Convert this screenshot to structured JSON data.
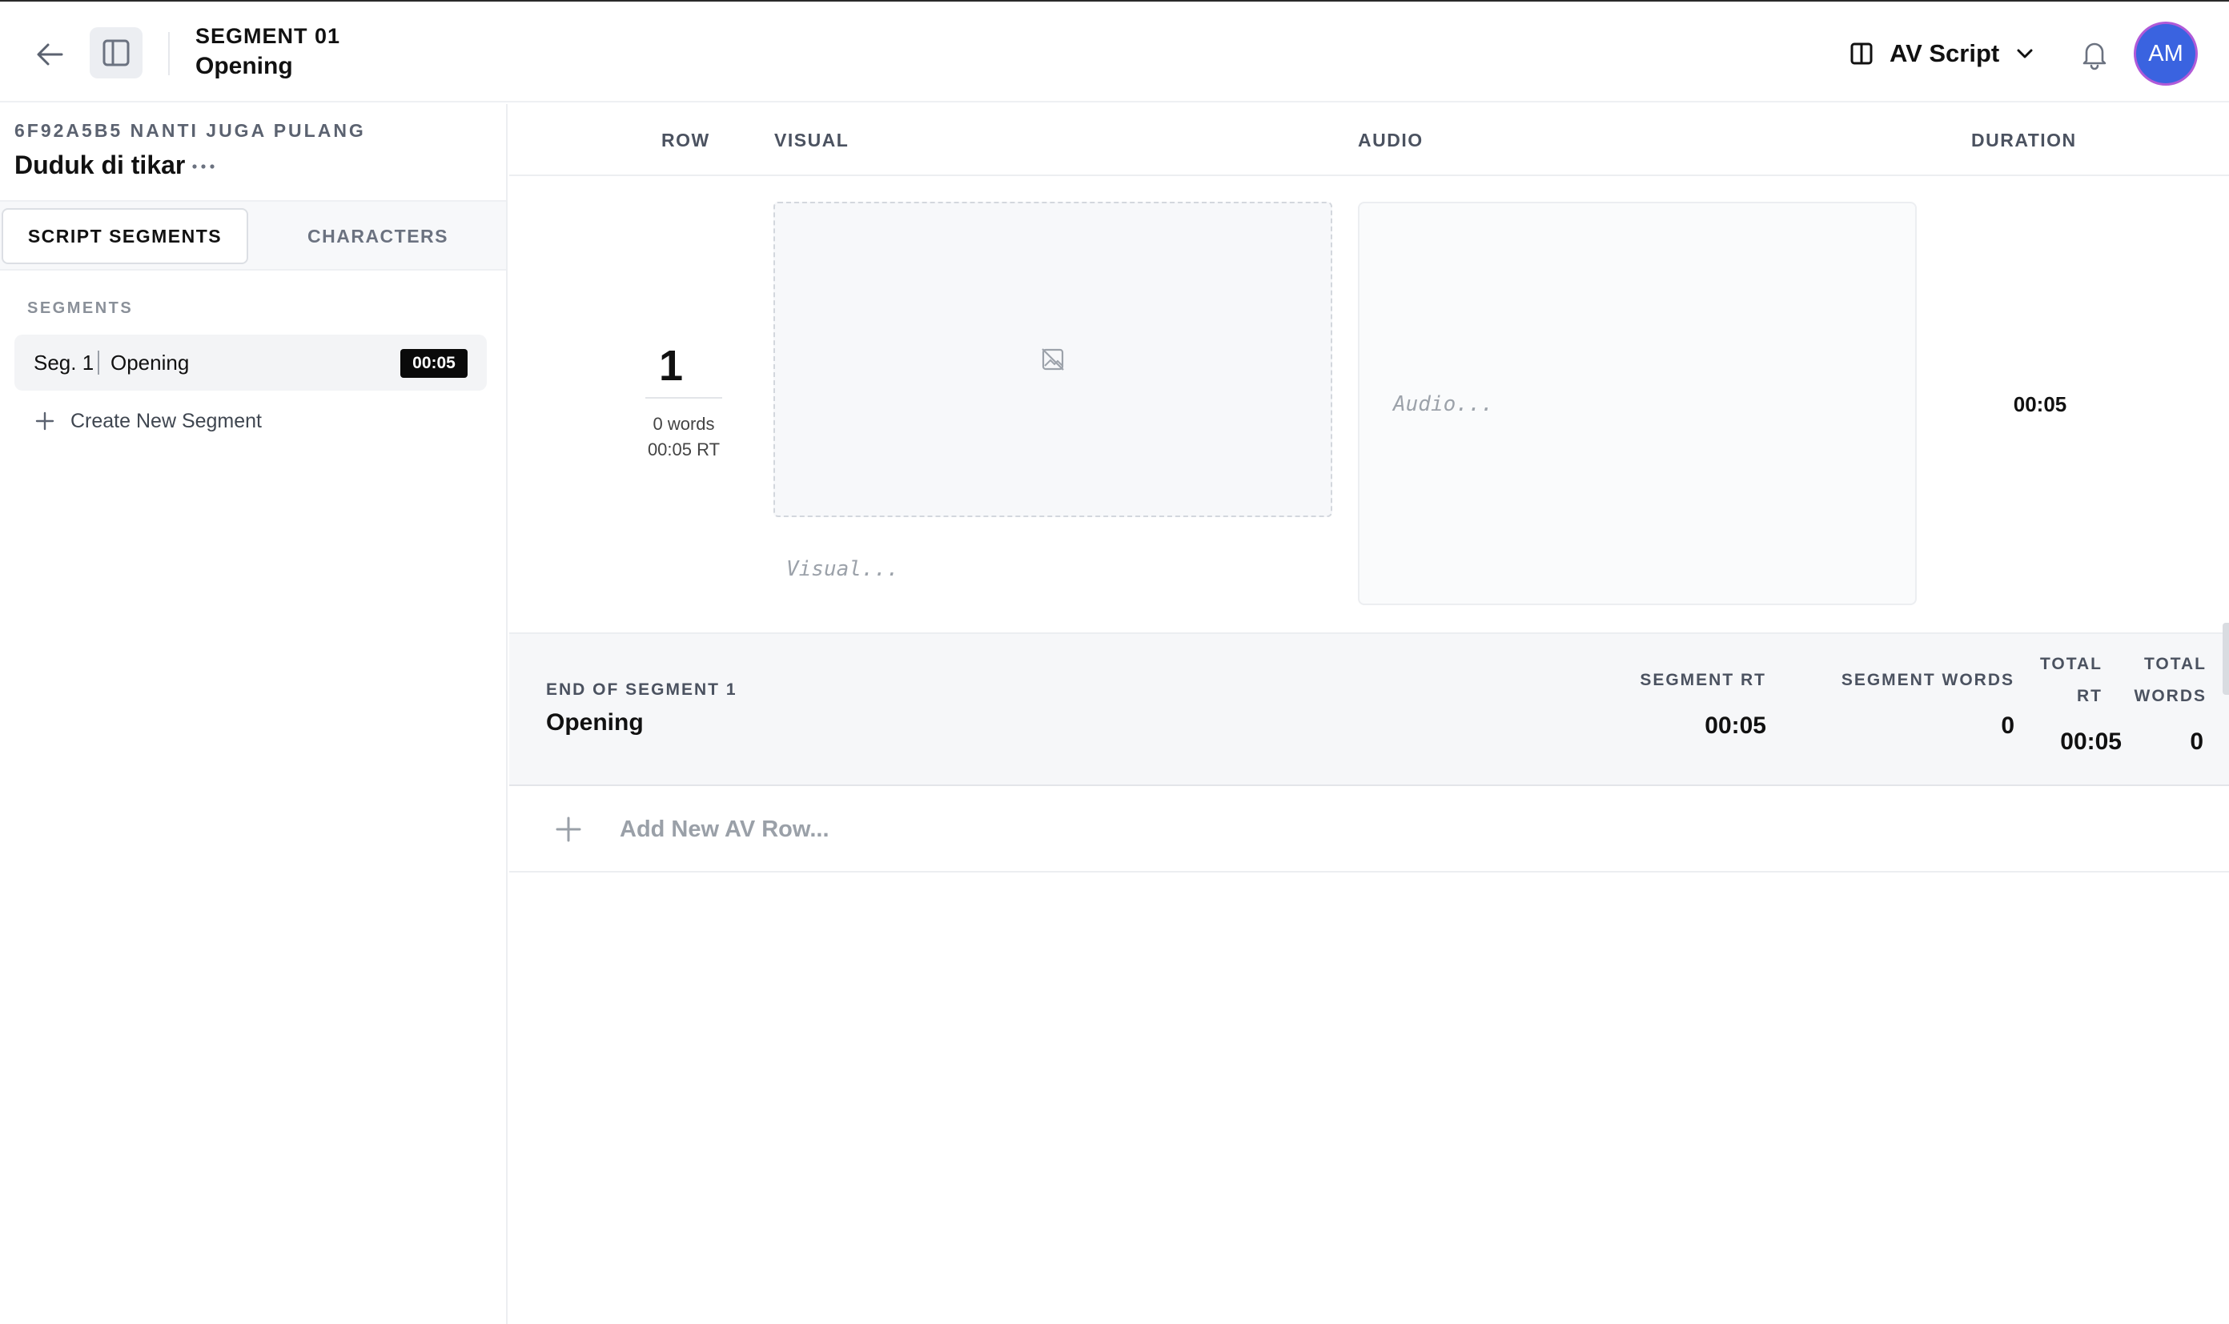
{
  "header": {
    "segment_number": "SEGMENT 01",
    "segment_name": "Opening",
    "view_mode": "AV Script",
    "user_initials": "AM"
  },
  "sidebar": {
    "project_id": "6F92A5B5 NANTI JUGA PULANG",
    "project_title": "Duduk di tikar",
    "tabs": [
      {
        "label": "SCRIPT SEGMENTS",
        "active": true
      },
      {
        "label": "CHARACTERS",
        "active": false
      }
    ],
    "segments_heading": "SEGMENTS",
    "segments": [
      {
        "label": "Seg. 1",
        "title": "Opening",
        "duration": "00:05"
      }
    ],
    "create_label": "Create New Segment"
  },
  "table": {
    "columns": {
      "row": "ROW",
      "visual": "VISUAL",
      "audio": "AUDIO",
      "duration": "DURATION"
    },
    "rows": [
      {
        "number": "1",
        "words": "0 words",
        "runtime": "00:05 RT",
        "visual_placeholder": "Visual...",
        "audio_placeholder": "Audio...",
        "duration": "00:05"
      }
    ]
  },
  "segment_summary": {
    "end_label": "END OF SEGMENT 1",
    "title": "Opening",
    "segment_rt_label": "SEGMENT RT",
    "segment_rt": "00:05",
    "segment_words_label": "SEGMENT WORDS",
    "segment_words": "0",
    "total_rt_label_1": "TOTAL",
    "total_rt_label_2": "RT",
    "total_rt": "00:05",
    "total_words_label_1": "TOTAL",
    "total_words_label_2": "WORDS",
    "total_words": "0"
  },
  "add_row_label": "Add New AV Row...",
  "icons": {
    "back": "arrow-left-icon",
    "sidebar": "sidebar-panel-icon",
    "view": "columns-icon",
    "dropdown": "chevron-down-icon",
    "bell": "bell-icon",
    "more": "more-horizontal-icon",
    "plus": "plus-icon",
    "no_image": "image-off-icon"
  },
  "colors": {
    "avatar_bg": "#3a63e0",
    "avatar_ring": "#b05ad8",
    "badge_bg": "#0a0a0a"
  }
}
